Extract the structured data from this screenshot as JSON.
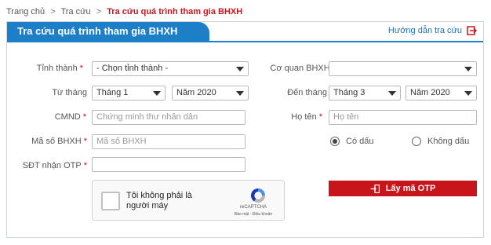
{
  "breadcrumb": {
    "home": "Trang chủ",
    "lookup": "Tra cứu",
    "current": "Tra cứu quá trình tham gia BHXH",
    "separator": ">"
  },
  "panel": {
    "title": "Tra cứu quá trình tham gia BHXH",
    "guide_link": "Hướng dẫn tra cứu"
  },
  "form": {
    "province_label": "Tỉnh thành",
    "province_value": "- Chọn tỉnh thành -",
    "agency_label": "Cơ quan BHXH",
    "agency_value": "",
    "from_month_label": "Từ tháng",
    "from_month_value": "Tháng 1",
    "from_year_value": "Năm 2020",
    "to_month_label": "Đến tháng",
    "to_month_value": "Tháng 3",
    "to_year_value": "Năm 2020",
    "id_label": "CMND",
    "id_placeholder": "Chứng minh thư nhân dân",
    "name_label": "Họ tên",
    "name_placeholder": "Họ tên",
    "bhxh_label": "Mã số BHXH",
    "bhxh_placeholder": "Mã số BHXH",
    "accent_option": "Có dấu",
    "no_accent_option": "Không dấu",
    "accent_selected": "Có dấu",
    "phone_label": "SĐT nhận OTP",
    "phone_value": "",
    "required_mark": "*"
  },
  "captcha": {
    "text": "Tôi không phải là người máy",
    "brand": "reCAPTCHA",
    "terms": "Bảo mật - Điều khoản"
  },
  "otp_button": "Lấy mã OTP",
  "colors": {
    "primary_blue": "#1e7fc9",
    "accent_red": "#c8151b"
  },
  "icons": {
    "guide": "edit-arrow-icon",
    "otp": "key-login-icon",
    "captcha": "recaptcha-logo-icon"
  }
}
